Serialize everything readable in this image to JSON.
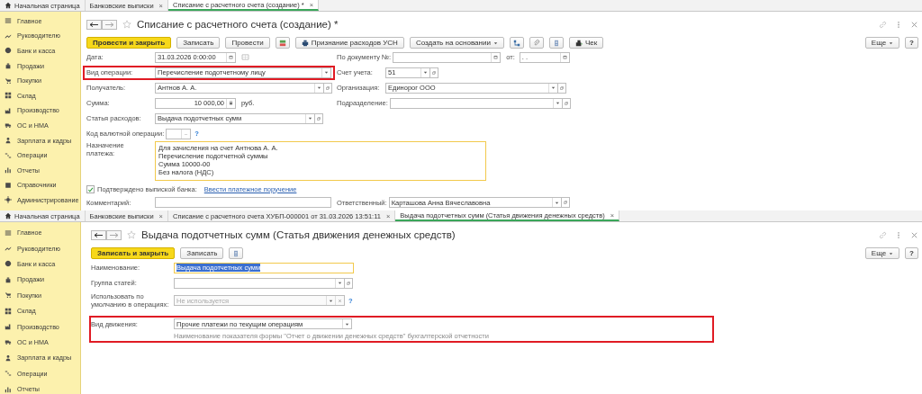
{
  "windows": [
    {
      "tabs": [
        {
          "label": "Начальная страница",
          "kind": "home",
          "selected": false
        },
        {
          "label": "Банковские выписки",
          "kind": "doc",
          "close": "×",
          "selected": false
        },
        {
          "label": "Списание с расчетного счета (создание) *",
          "kind": "doc",
          "close": "×",
          "selected": true
        }
      ],
      "sidebar": [
        "Главное",
        "Руководителю",
        "Банк и касса",
        "Продажи",
        "Покупки",
        "Склад",
        "Производство",
        "ОС и НМА",
        "Зарплата и кадры",
        "Операции",
        "Отчеты",
        "Справочники",
        "Администрирование"
      ],
      "title": "Списание с расчетного счета (создание) *",
      "toolbar": [
        {
          "kind": "primary",
          "label": "Провести и закрыть"
        },
        {
          "kind": "plain",
          "label": "Записать"
        },
        {
          "kind": "plain",
          "label": "Провести"
        },
        {
          "kind": "ledger"
        },
        {
          "kind": "print",
          "label": "Признание расходов УСН"
        },
        {
          "kind": "menu",
          "label": "Создать на основании"
        },
        {
          "kind": "structure"
        },
        {
          "kind": "attach"
        },
        {
          "kind": "list"
        },
        {
          "kind": "receipt",
          "label": "Чек"
        }
      ],
      "more": "Еще",
      "help": "?",
      "rows": [
        {
          "left": {
            "kind": "date",
            "label": "Дата:",
            "value": "31.03.2026  0:00:00",
            "side_icon": true
          },
          "right": {
            "kind": "docnum",
            "label": "По документу №:",
            "date_label": "от:",
            "date_value": " .  ."
          }
        },
        {
          "left": {
            "kind": "select",
            "label": "Вид операции:",
            "value": "Перечисление подотчетному лицу",
            "highlighted": true
          },
          "right": {
            "kind": "select",
            "label": "Счет учета:",
            "value": "51",
            "open": true
          }
        },
        {
          "left": {
            "kind": "select",
            "label": "Получатель:",
            "value": "Антнов А. А.",
            "open": true
          },
          "right": {
            "kind": "select",
            "label": "Организация:",
            "value": "Единорог ООО",
            "open": true
          }
        },
        {
          "left": {
            "kind": "number",
            "label": "Сумма:",
            "value": "10 000,00",
            "unit": "руб."
          },
          "right": {
            "kind": "select",
            "label": "Подразделение:",
            "open": true
          }
        },
        {
          "left": {
            "kind": "select",
            "label": "Статья расходов:",
            "value": "Выдача подотчетных сумм",
            "open": true
          }
        },
        {
          "left": {
            "kind": "code",
            "label": "Код валютной операции:",
            "help": "?"
          }
        },
        {
          "left": {
            "kind": "textarea",
            "label": "Назначение платежа:",
            "lines": [
              "Для зачисления на счет Антнова А. А.",
              "Перечисление подотчетной суммы",
              "Сумма 10000-00",
              "Без налога (НДС)"
            ],
            "focused": true
          }
        },
        {
          "left": {
            "kind": "check",
            "label": "Подтверждено выпиской банка:",
            "checked": true,
            "link": "Ввести платежное поручение"
          }
        },
        {
          "left": {
            "kind": "text",
            "label": "Комментарий:"
          },
          "right": {
            "kind": "select",
            "label": "Ответственный:",
            "value": "Карташова Анна Вячеславовна",
            "open": true
          }
        }
      ]
    },
    {
      "tabs": [
        {
          "label": "Начальная страница",
          "kind": "home",
          "selected": false
        },
        {
          "label": "Банковские выписки",
          "kind": "doc",
          "close": "×",
          "selected": false
        },
        {
          "label": "Списание с расчетного счета ХУБП-000001 от 31.03.2026 13:51:11",
          "kind": "doc",
          "close": "×",
          "selected": false
        },
        {
          "label": "Выдача подотчетных сумм (Статья движения денежных средств)",
          "kind": "doc",
          "close": "×",
          "selected": true
        }
      ],
      "sidebar": [
        "Главное",
        "Руководителю",
        "Банк и касса",
        "Продажи",
        "Покупки",
        "Склад",
        "Производство",
        "ОС и НМА",
        "Зарплата и кадры",
        "Операции",
        "Отчеты"
      ],
      "title": "Выдача подотчетных сумм (Статья движения денежных средств)",
      "toolbar": [
        {
          "kind": "primary",
          "label": "Записать и закрыть"
        },
        {
          "kind": "plain",
          "label": "Записать"
        },
        {
          "kind": "list"
        }
      ],
      "more": "Еще",
      "help": "?",
      "rows": [
        {
          "left": {
            "kind": "text",
            "label": "Наименование:",
            "value": "Выдача подотчетных сумм",
            "focused": true,
            "text_selected": true
          }
        },
        {
          "left": {
            "kind": "select",
            "label": "Группа статей:",
            "open": true
          }
        },
        {
          "left": {
            "kind": "select",
            "label": "Использовать по умолчанию в операциях:",
            "placeholder": "Не используется",
            "clear": true,
            "help": "?"
          }
        },
        {
          "left": {
            "kind": "select",
            "label": "Вид движения:",
            "value": "Прочие платежи по текущим операциям",
            "highlighted": true,
            "hint": "Наименование показателя формы \"Отчет о движении денежных средств\" бухгалтерской отчетности"
          }
        }
      ]
    }
  ]
}
